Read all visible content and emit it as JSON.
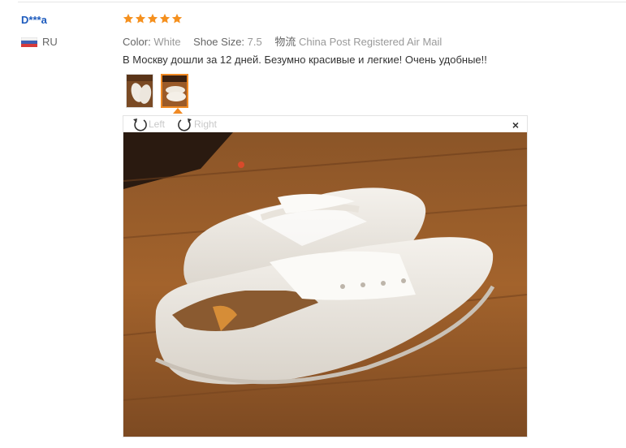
{
  "review": {
    "user": "D***a",
    "country": "RU",
    "rating_stars": 5,
    "attributes": [
      {
        "key": "Color:",
        "value": "White"
      },
      {
        "key": "Shoe Size:",
        "value": "7.5"
      },
      {
        "key": "物流",
        "value": "China Post Registered Air Mail"
      }
    ],
    "text": "В Москву дошли за 12 дней. Безумно красивые и легкие! Очень удобные!!"
  },
  "viewer": {
    "left_label": "Left",
    "right_label": "Right",
    "close_label": "×"
  },
  "colors": {
    "star": "#f5901e",
    "user_link": "#1d5bbd",
    "thumb_active_border": "#f08a24"
  }
}
